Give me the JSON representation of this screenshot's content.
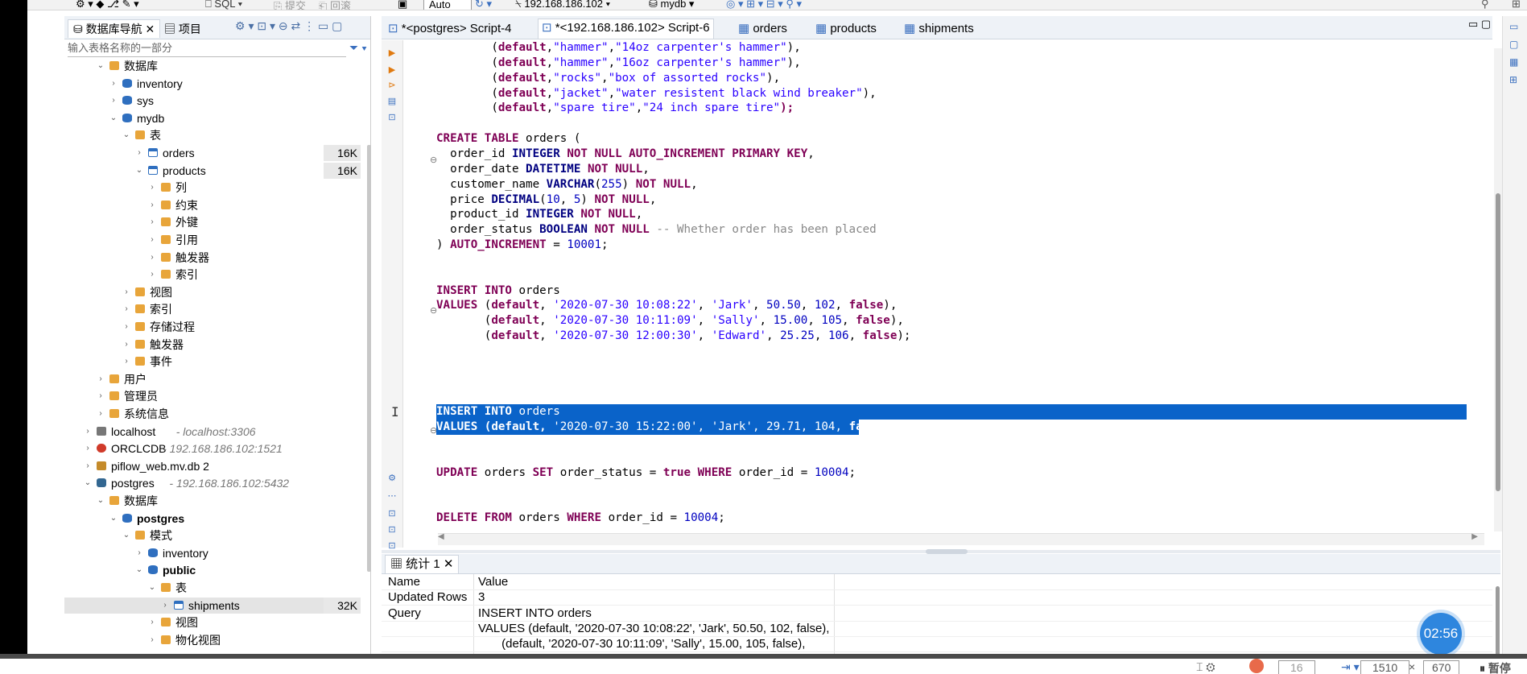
{
  "toolbar": {
    "sql_label": "SQL",
    "commit_label": "提交",
    "rollback_label": "回滚",
    "mode": "Auto",
    "connection": "192.168.186.102",
    "database": "mydb"
  },
  "navigator": {
    "tab_db_nav": "数据库导航",
    "tab_project": "项目",
    "filter_placeholder": "输入表格名称的一部分",
    "tree": [
      {
        "label": "数据库",
        "sub": "",
        "size": "",
        "level": 2,
        "expanded": true,
        "icon": "folder-icon"
      },
      {
        "label": "inventory",
        "sub": "",
        "size": "",
        "level": 3,
        "expanded": false,
        "icon": "database-icon"
      },
      {
        "label": "sys",
        "sub": "",
        "size": "",
        "level": 3,
        "expanded": false,
        "icon": "database-icon"
      },
      {
        "label": "mydb",
        "sub": "",
        "size": "",
        "level": 3,
        "expanded": true,
        "icon": "database-icon"
      },
      {
        "label": "表",
        "sub": "",
        "size": "",
        "level": 4,
        "expanded": true,
        "icon": "folder-icon"
      },
      {
        "label": "orders",
        "sub": "",
        "size": "16K",
        "level": 5,
        "expanded": false,
        "icon": "table-icon"
      },
      {
        "label": "products",
        "sub": "",
        "size": "16K",
        "level": 5,
        "expanded": true,
        "icon": "table-icon"
      },
      {
        "label": "列",
        "sub": "",
        "size": "",
        "level": 6,
        "expanded": false,
        "icon": "folder-icon"
      },
      {
        "label": "约束",
        "sub": "",
        "size": "",
        "level": 6,
        "expanded": false,
        "icon": "folder-icon"
      },
      {
        "label": "外键",
        "sub": "",
        "size": "",
        "level": 6,
        "expanded": false,
        "icon": "folder-icon"
      },
      {
        "label": "引用",
        "sub": "",
        "size": "",
        "level": 6,
        "expanded": false,
        "icon": "folder-icon"
      },
      {
        "label": "触发器",
        "sub": "",
        "size": "",
        "level": 6,
        "expanded": false,
        "icon": "folder-icon"
      },
      {
        "label": "索引",
        "sub": "",
        "size": "",
        "level": 6,
        "expanded": false,
        "icon": "folder-icon"
      },
      {
        "label": "视图",
        "sub": "",
        "size": "",
        "level": 4,
        "expanded": false,
        "icon": "folder-icon"
      },
      {
        "label": "索引",
        "sub": "",
        "size": "",
        "level": 4,
        "expanded": false,
        "icon": "folder-icon"
      },
      {
        "label": "存储过程",
        "sub": "",
        "size": "",
        "level": 4,
        "expanded": false,
        "icon": "folder-icon"
      },
      {
        "label": "触发器",
        "sub": "",
        "size": "",
        "level": 4,
        "expanded": false,
        "icon": "folder-icon"
      },
      {
        "label": "事件",
        "sub": "",
        "size": "",
        "level": 4,
        "expanded": false,
        "icon": "folder-icon"
      },
      {
        "label": "用户",
        "sub": "",
        "size": "",
        "level": 2,
        "expanded": false,
        "icon": "folder-icon"
      },
      {
        "label": "管理员",
        "sub": "",
        "size": "",
        "level": 2,
        "expanded": false,
        "icon": "folder-icon"
      },
      {
        "label": "系统信息",
        "sub": "",
        "size": "",
        "level": 2,
        "expanded": false,
        "icon": "folder-icon"
      },
      {
        "label": "localhost",
        "sub": " - localhost:3306",
        "size": "",
        "level": 1,
        "expanded": false,
        "icon": "connection-icon"
      },
      {
        "label": "ORCLCDB",
        "sub": " - 192.168.186.102:1521",
        "size": "",
        "level": 1,
        "expanded": false,
        "icon": "oracle-icon"
      },
      {
        "label": "piflow_web.mv.db 2",
        "sub": "",
        "size": "",
        "level": 1,
        "expanded": false,
        "icon": "file-db-icon"
      },
      {
        "label": "postgres",
        "sub": " - 192.168.186.102:5432",
        "size": "",
        "level": 1,
        "expanded": true,
        "icon": "postgres-icon"
      },
      {
        "label": "数据库",
        "sub": "",
        "size": "",
        "level": 2,
        "expanded": true,
        "icon": "folder-icon"
      },
      {
        "label": "postgres",
        "sub": "",
        "size": "",
        "level": 3,
        "expanded": true,
        "icon": "database-icon",
        "bold": true
      },
      {
        "label": "模式",
        "sub": "",
        "size": "",
        "level": 4,
        "expanded": true,
        "icon": "folder-icon"
      },
      {
        "label": "inventory",
        "sub": "",
        "size": "",
        "level": 5,
        "expanded": false,
        "icon": "schema-icon"
      },
      {
        "label": "public",
        "sub": "",
        "size": "",
        "level": 5,
        "expanded": true,
        "icon": "schema-icon",
        "bold": true
      },
      {
        "label": "表",
        "sub": "",
        "size": "",
        "level": 6,
        "expanded": true,
        "icon": "folder-icon"
      },
      {
        "label": "shipments",
        "sub": "",
        "size": "32K",
        "level": 7,
        "expanded": false,
        "icon": "table-icon",
        "selected": true
      },
      {
        "label": "视图",
        "sub": "",
        "size": "",
        "level": 6,
        "expanded": false,
        "icon": "folder-icon"
      },
      {
        "label": "物化视图",
        "sub": "",
        "size": "",
        "level": 6,
        "expanded": false,
        "icon": "folder-icon"
      }
    ]
  },
  "editor": {
    "tabs": [
      {
        "label": "*<postgres> Script-4",
        "active": false
      },
      {
        "label": "*<192.168.186.102> Script-6",
        "active": true
      },
      {
        "label": "orders",
        "active": false
      },
      {
        "label": "products",
        "active": false
      },
      {
        "label": "shipments",
        "active": false
      }
    ]
  },
  "code_lines": [
    [
      [
        "        (",
        ""
      ],
      [
        "default",
        "k"
      ],
      [
        ",",
        ""
      ],
      [
        "\"hammer\"",
        "s"
      ],
      [
        ",",
        ""
      ],
      [
        "\"14oz carpenter's hammer\"",
        "s"
      ],
      [
        "),",
        ""
      ]
    ],
    [
      [
        "        (",
        ""
      ],
      [
        "default",
        "k"
      ],
      [
        ",",
        ""
      ],
      [
        "\"hammer\"",
        "s"
      ],
      [
        ",",
        ""
      ],
      [
        "\"16oz carpenter's hammer\"",
        "s"
      ],
      [
        "),",
        ""
      ]
    ],
    [
      [
        "        (",
        ""
      ],
      [
        "default",
        "k"
      ],
      [
        ",",
        ""
      ],
      [
        "\"rocks\"",
        "s"
      ],
      [
        ",",
        ""
      ],
      [
        "\"box of assorted rocks\"",
        "s"
      ],
      [
        "),",
        ""
      ]
    ],
    [
      [
        "        (",
        ""
      ],
      [
        "default",
        "k"
      ],
      [
        ",",
        ""
      ],
      [
        "\"jacket\"",
        "s"
      ],
      [
        ",",
        ""
      ],
      [
        "\"water resistent black wind breaker\"",
        "s"
      ],
      [
        "),",
        ""
      ]
    ],
    [
      [
        "        (",
        ""
      ],
      [
        "default",
        "k"
      ],
      [
        ",",
        ""
      ],
      [
        "\"spare tire\"",
        "s"
      ],
      [
        ",",
        ""
      ],
      [
        "\"24 inch spare tire\"",
        "s"
      ],
      [
        ");",
        "k"
      ]
    ],
    [],
    [
      [
        "CREATE TABLE",
        "k"
      ],
      [
        " orders (",
        ""
      ]
    ],
    [
      [
        "  order_id ",
        ""
      ],
      [
        "INTEGER",
        "kb"
      ],
      [
        " ",
        ""
      ],
      [
        "NOT NULL AUTO_INCREMENT PRIMARY KEY",
        "k"
      ],
      [
        ",",
        ""
      ]
    ],
    [
      [
        "  order_date ",
        ""
      ],
      [
        "DATETIME",
        "kb"
      ],
      [
        " ",
        ""
      ],
      [
        "NOT NULL",
        "k"
      ],
      [
        ",",
        ""
      ]
    ],
    [
      [
        "  customer_name ",
        ""
      ],
      [
        "VARCHAR",
        "kb"
      ],
      [
        "(",
        ""
      ],
      [
        "255",
        "n"
      ],
      [
        ") ",
        ""
      ],
      [
        "NOT NULL",
        "k"
      ],
      [
        ",",
        ""
      ]
    ],
    [
      [
        "  price ",
        ""
      ],
      [
        "DECIMAL",
        "kb"
      ],
      [
        "(",
        ""
      ],
      [
        "10",
        "n"
      ],
      [
        ", ",
        ""
      ],
      [
        "5",
        "n"
      ],
      [
        ") ",
        ""
      ],
      [
        "NOT NULL",
        "k"
      ],
      [
        ",",
        ""
      ]
    ],
    [
      [
        "  product_id ",
        ""
      ],
      [
        "INTEGER",
        "kb"
      ],
      [
        " ",
        ""
      ],
      [
        "NOT NULL",
        "k"
      ],
      [
        ",",
        ""
      ]
    ],
    [
      [
        "  order_status ",
        ""
      ],
      [
        "BOOLEAN",
        "kb"
      ],
      [
        " ",
        ""
      ],
      [
        "NOT NULL",
        "k"
      ],
      [
        " ",
        ""
      ],
      [
        "-- Whether order has been placed",
        "c"
      ]
    ],
    [
      [
        ") ",
        ""
      ],
      [
        "AUTO_INCREMENT",
        "k"
      ],
      [
        " = ",
        ""
      ],
      [
        "10001",
        "n"
      ],
      [
        ";",
        ""
      ]
    ],
    [],
    [],
    [
      [
        "INSERT INTO",
        "k"
      ],
      [
        " orders",
        ""
      ]
    ],
    [
      [
        "VALUES",
        "k"
      ],
      [
        " (",
        ""
      ],
      [
        "default",
        "k"
      ],
      [
        ", ",
        ""
      ],
      [
        "'2020-07-30 10:08:22'",
        "s"
      ],
      [
        ", ",
        ""
      ],
      [
        "'Jark'",
        "s"
      ],
      [
        ", ",
        ""
      ],
      [
        "50.50",
        "n"
      ],
      [
        ", ",
        ""
      ],
      [
        "102",
        "n"
      ],
      [
        ", ",
        ""
      ],
      [
        "false",
        "k"
      ],
      [
        "),",
        ""
      ]
    ],
    [
      [
        "       (",
        ""
      ],
      [
        "default",
        "k"
      ],
      [
        ", ",
        ""
      ],
      [
        "'2020-07-30 10:11:09'",
        "s"
      ],
      [
        ", ",
        ""
      ],
      [
        "'Sally'",
        "s"
      ],
      [
        ", ",
        ""
      ],
      [
        "15.00",
        "n"
      ],
      [
        ", ",
        ""
      ],
      [
        "105",
        "n"
      ],
      [
        ", ",
        ""
      ],
      [
        "false",
        "k"
      ],
      [
        "),",
        ""
      ]
    ],
    [
      [
        "       (",
        ""
      ],
      [
        "default",
        "k"
      ],
      [
        ", ",
        ""
      ],
      [
        "'2020-07-30 12:00:30'",
        "s"
      ],
      [
        ", ",
        ""
      ],
      [
        "'Edward'",
        "s"
      ],
      [
        ", ",
        ""
      ],
      [
        "25.25",
        "n"
      ],
      [
        ", ",
        ""
      ],
      [
        "106",
        "n"
      ],
      [
        ", ",
        ""
      ],
      [
        "false",
        "k"
      ],
      [
        ");",
        ""
      ]
    ],
    [],
    [],
    [],
    [],
    [
      [
        "INSERT INTO",
        "k"
      ],
      [
        " orders",
        ""
      ]
    ],
    [
      [
        "VALUES (default, ",
        "k"
      ],
      [
        "'2020-07-30 15:22:00'",
        "s"
      ],
      [
        ", ",
        ""
      ],
      [
        "'Jark'",
        "s"
      ],
      [
        ", ",
        ""
      ],
      [
        "29.71",
        "n"
      ],
      [
        ", ",
        ""
      ],
      [
        "104",
        "n"
      ],
      [
        ", ",
        ""
      ],
      [
        "false",
        "k"
      ],
      [
        ");",
        ""
      ]
    ],
    [],
    [],
    [
      [
        "UPDATE",
        "k"
      ],
      [
        " orders ",
        ""
      ],
      [
        "SET",
        "k"
      ],
      [
        " order_status = ",
        ""
      ],
      [
        "true",
        "k"
      ],
      [
        " ",
        ""
      ],
      [
        "WHERE",
        "k"
      ],
      [
        " order_id = ",
        ""
      ],
      [
        "10004",
        "n"
      ],
      [
        ";",
        ""
      ]
    ],
    [],
    [],
    [
      [
        "DELETE FROM",
        "k"
      ],
      [
        " orders ",
        ""
      ],
      [
        "WHERE",
        "k"
      ],
      [
        " order_id = ",
        ""
      ],
      [
        "10004",
        "n"
      ],
      [
        ";",
        ""
      ]
    ]
  ],
  "results": {
    "tab_label": "统计 1",
    "columns": [
      "Name",
      "Value"
    ],
    "rows": [
      {
        "name": "Updated Rows",
        "value": "3"
      },
      {
        "name": "Query",
        "value": "INSERT INTO orders"
      },
      {
        "name": "",
        "value": "VALUES (default, '2020-07-30 10:08:22', 'Jark', 50.50, 102, false),"
      },
      {
        "name": "",
        "value": "       (default, '2020-07-30 10:11:09', 'Sally', 15.00, 105, false),"
      }
    ]
  },
  "timer": "02:56",
  "statusbar": {
    "line_field": "16",
    "pos1": "1510",
    "pos2": "670",
    "label": "暂停"
  }
}
